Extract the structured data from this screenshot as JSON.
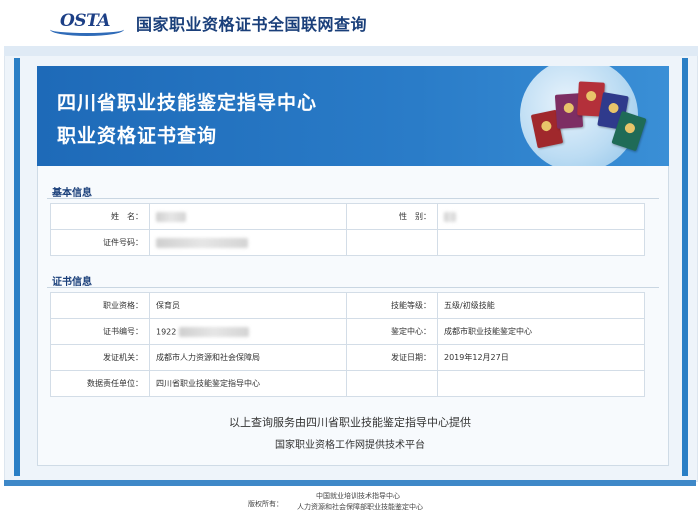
{
  "header": {
    "logo_text": "OSTA",
    "site_title": "国家职业资格证书全国联网查询"
  },
  "banner": {
    "title_line1": "四川省职业技能鉴定指导中心",
    "title_line2": "职业资格证书查询"
  },
  "basic_info": {
    "section_title": "基本信息",
    "name_label": "姓　名：",
    "gender_label": "性　别：",
    "id_label": "证件号码："
  },
  "cert_info": {
    "section_title": "证书信息",
    "qualification_label": "职业资格：",
    "qualification_value": "保育员",
    "skill_level_label": "技能等级：",
    "skill_level_value": "五级/初级技能",
    "cert_no_label": "证书编号：",
    "cert_no_value": "1922",
    "center_label": "鉴定中心：",
    "center_value": "成都市职业技能鉴定中心",
    "issuer_label": "发证机关：",
    "issuer_value": "成都市人力资源和社会保障局",
    "issue_date_label": "发证日期：",
    "issue_date_value": "2019年12月27日",
    "responsible_label": "数据责任单位：",
    "responsible_value": "四川省职业技能鉴定指导中心"
  },
  "footer": {
    "line1": "以上查询服务由四川省职业技能鉴定指导中心提供",
    "line2": "国家职业资格工作网提供技术平台",
    "copyright_label": "版权所有：",
    "copyright_org1": "中国就业培训技术指导中心",
    "copyright_org2": "人力资源和社会保障部职业技能鉴定中心"
  },
  "colors": {
    "banner_blue": "#2a7cc8",
    "title_navy": "#1a3f7a"
  }
}
